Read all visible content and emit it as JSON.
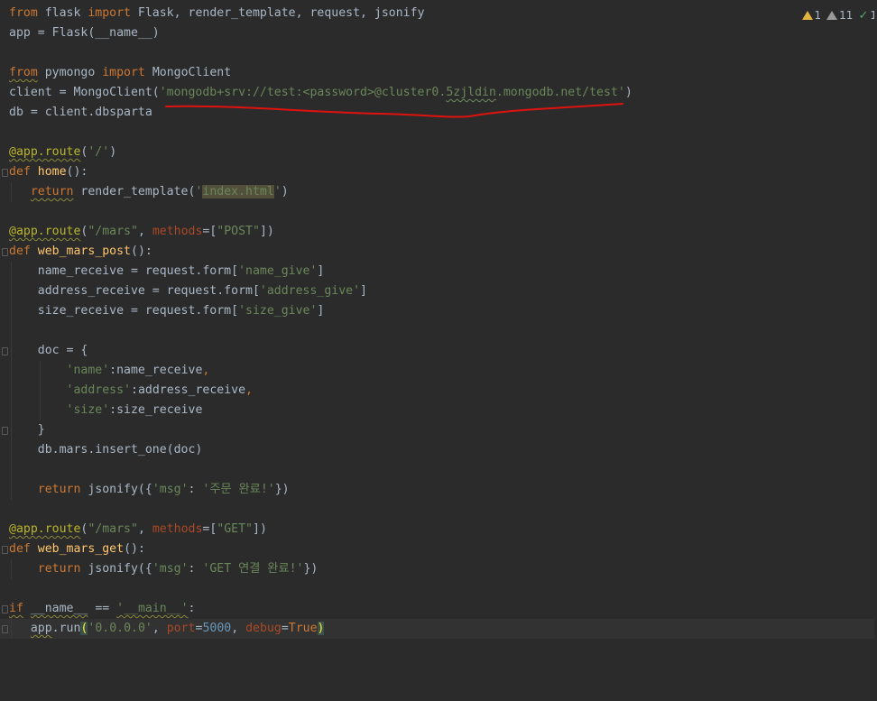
{
  "inspections": {
    "warnings": "1",
    "weak_warnings": "11",
    "ok": "1"
  },
  "colors": {
    "background": "#2b2b2b",
    "keyword": "#cc7832",
    "string": "#6a8759",
    "number": "#6897bb",
    "decorator": "#bbb529",
    "function": "#ffc66d",
    "annotation_line": "#e0120e"
  },
  "lines": [
    [
      [
        "kw",
        "from"
      ],
      [
        "plain",
        " flask "
      ],
      [
        "kw",
        "import"
      ],
      [
        "plain",
        " Flask, render_template, request, jsonify"
      ]
    ],
    [
      [
        "plain",
        "app = Flask(__name__)"
      ]
    ],
    [],
    [
      [
        "kw warn",
        "from"
      ],
      [
        "plain",
        " pymongo "
      ],
      [
        "kw",
        "import"
      ],
      [
        "plain",
        " MongoClient"
      ]
    ],
    [
      [
        "plain",
        "client = MongoClient("
      ],
      [
        "str",
        "'mongodb+srv://test:<password>@cluster0."
      ],
      [
        "str typo",
        "5zjldin"
      ],
      [
        "str",
        ".mongodb.net/test'"
      ],
      [
        "plain",
        ")"
      ]
    ],
    [
      [
        "plain",
        "db = client.dbsparta"
      ]
    ],
    [],
    [
      [
        "deco warn",
        "@app.route"
      ],
      [
        "plain",
        "("
      ],
      [
        "str",
        "'/'"
      ],
      [
        "plain",
        ")"
      ]
    ],
    [
      [
        "kw",
        "def"
      ],
      [
        "plain",
        " "
      ],
      [
        "fn",
        "home"
      ],
      [
        "plain",
        "():"
      ]
    ],
    [
      [
        "plain",
        "   "
      ],
      [
        "kw warn",
        "return"
      ],
      [
        "plain",
        " render_template("
      ],
      [
        "str",
        "'"
      ],
      [
        "str hl",
        "index.html"
      ],
      [
        "str",
        "'"
      ],
      [
        "plain",
        ")"
      ]
    ],
    [],
    [
      [
        "deco warn",
        "@app.route"
      ],
      [
        "plain",
        "("
      ],
      [
        "str",
        "\"/mars\""
      ],
      [
        "plain",
        ", "
      ],
      [
        "kwarg",
        "methods"
      ],
      [
        "plain",
        "=["
      ],
      [
        "str",
        "\"POST\""
      ],
      [
        "plain",
        "])"
      ]
    ],
    [
      [
        "kw",
        "def"
      ],
      [
        "plain",
        " "
      ],
      [
        "fn",
        "web_mars_post"
      ],
      [
        "plain",
        "():"
      ]
    ],
    [
      [
        "plain",
        "    name_receive = request.form["
      ],
      [
        "str",
        "'name_give'"
      ],
      [
        "plain",
        "]"
      ]
    ],
    [
      [
        "plain",
        "    address_receive = request.form["
      ],
      [
        "str",
        "'address_give'"
      ],
      [
        "plain",
        "]"
      ]
    ],
    [
      [
        "plain",
        "    size_receive = request.form["
      ],
      [
        "str",
        "'size_give'"
      ],
      [
        "plain",
        "]"
      ]
    ],
    [],
    [
      [
        "plain",
        "    doc = {"
      ]
    ],
    [
      [
        "plain",
        "        "
      ],
      [
        "str",
        "'name'"
      ],
      [
        "plain",
        ":name_receive"
      ],
      [
        "kw",
        ","
      ]
    ],
    [
      [
        "plain",
        "        "
      ],
      [
        "str",
        "'address'"
      ],
      [
        "plain",
        ":address_receive"
      ],
      [
        "kw",
        ","
      ]
    ],
    [
      [
        "plain",
        "        "
      ],
      [
        "str",
        "'size'"
      ],
      [
        "plain",
        ":size_receive"
      ]
    ],
    [
      [
        "plain",
        "    }"
      ]
    ],
    [
      [
        "plain",
        "    db.mars.insert_one(doc)"
      ]
    ],
    [],
    [
      [
        "plain",
        "    "
      ],
      [
        "kw",
        "return"
      ],
      [
        "plain",
        " jsonify({"
      ],
      [
        "str",
        "'msg'"
      ],
      [
        "plain",
        ": "
      ],
      [
        "str",
        "'주문 완료!'"
      ],
      [
        "plain",
        "})"
      ]
    ],
    [],
    [
      [
        "deco warn",
        "@app.route"
      ],
      [
        "plain",
        "("
      ],
      [
        "str",
        "\"/mars\""
      ],
      [
        "plain",
        ", "
      ],
      [
        "kwarg",
        "methods"
      ],
      [
        "plain",
        "=["
      ],
      [
        "str",
        "\"GET\""
      ],
      [
        "plain",
        "])"
      ]
    ],
    [
      [
        "kw",
        "def"
      ],
      [
        "plain",
        " "
      ],
      [
        "fn",
        "web_mars_get"
      ],
      [
        "plain",
        "():"
      ]
    ],
    [
      [
        "plain",
        "    "
      ],
      [
        "kw",
        "return"
      ],
      [
        "plain",
        " jsonify({"
      ],
      [
        "str",
        "'msg'"
      ],
      [
        "plain",
        ": "
      ],
      [
        "str",
        "'GET 연결 완료!'"
      ],
      [
        "plain",
        "})"
      ]
    ],
    [],
    [
      [
        "kw warn",
        "if"
      ],
      [
        "plain",
        " "
      ],
      [
        "plain warn",
        "__name__"
      ],
      [
        "plain",
        " == "
      ],
      [
        "str warn",
        "'__main__'"
      ],
      [
        "plain",
        ":"
      ]
    ],
    [
      [
        "plain",
        "   "
      ],
      [
        "plain warn",
        "app"
      ],
      [
        "plain",
        ".run"
      ],
      [
        "brace-match",
        "("
      ],
      [
        "str",
        "'0.0.0.0'"
      ],
      [
        "plain",
        ", "
      ],
      [
        "kwarg",
        "port"
      ],
      [
        "plain",
        "="
      ],
      [
        "num",
        "5000"
      ],
      [
        "plain",
        ", "
      ],
      [
        "kwarg",
        "debug"
      ],
      [
        "plain",
        "="
      ],
      [
        "kw",
        "True"
      ],
      [
        "brace-match",
        ")"
      ]
    ]
  ]
}
